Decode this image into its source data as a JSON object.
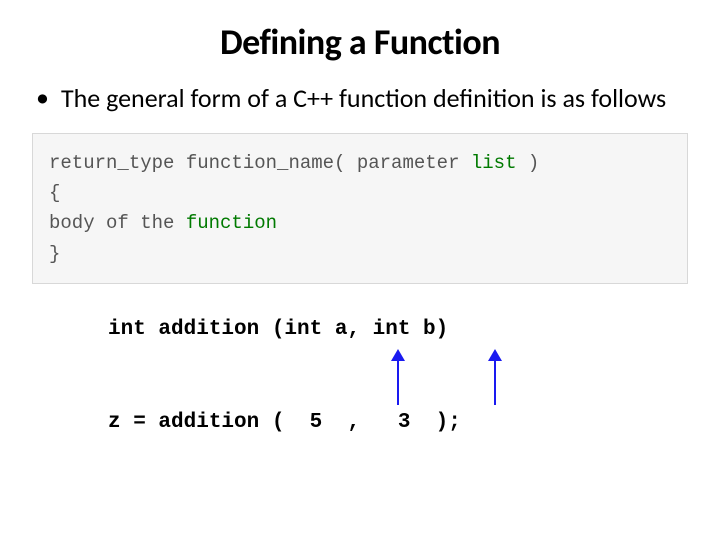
{
  "title": "Defining a Function",
  "bullet": "The general form of a C++ function definition is as follows",
  "code": {
    "line1a": "return_type function_name( parameter ",
    "line1b": "list",
    "line1c": " )",
    "line2": "{",
    "line3a": "   body of the ",
    "line3b": "function",
    "line4": "}"
  },
  "example": {
    "decl": "int addition (int a, int b)",
    "call": "z = addition (  5  ,   3  );"
  }
}
